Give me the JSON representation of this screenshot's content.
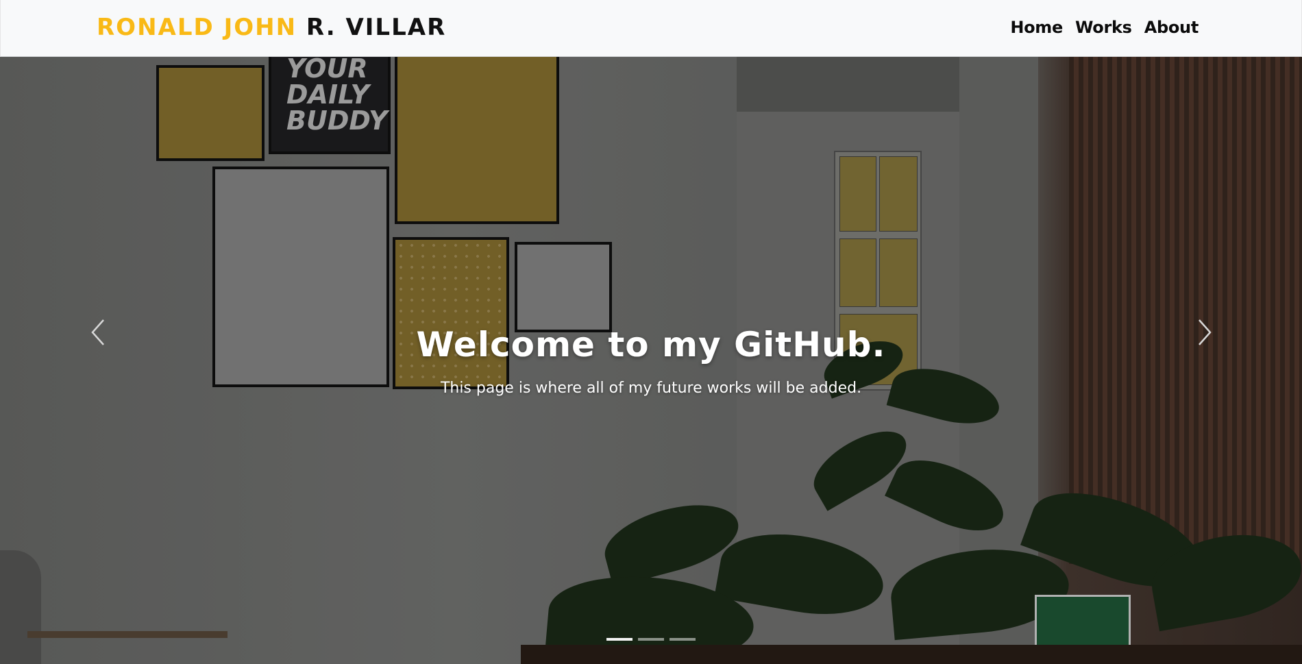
{
  "navbar": {
    "brand_first": "RONALD JOHN",
    "brand_last": "R. VILLAR",
    "links": [
      {
        "label": "Home"
      },
      {
        "label": "Works"
      },
      {
        "label": "About"
      }
    ]
  },
  "hero": {
    "title": "Welcome to my GitHub.",
    "subtitle": "This page is where all of my future works will be added.",
    "prev_icon": "chevron-left-icon",
    "next_icon": "chevron-right-icon",
    "slide_count": 3,
    "active_slide": 1
  },
  "colors": {
    "brand_accent": "#f9b916",
    "brand_dark": "#111111",
    "navbar_bg": "#f8f9fa",
    "hero_text": "#ffffff"
  }
}
